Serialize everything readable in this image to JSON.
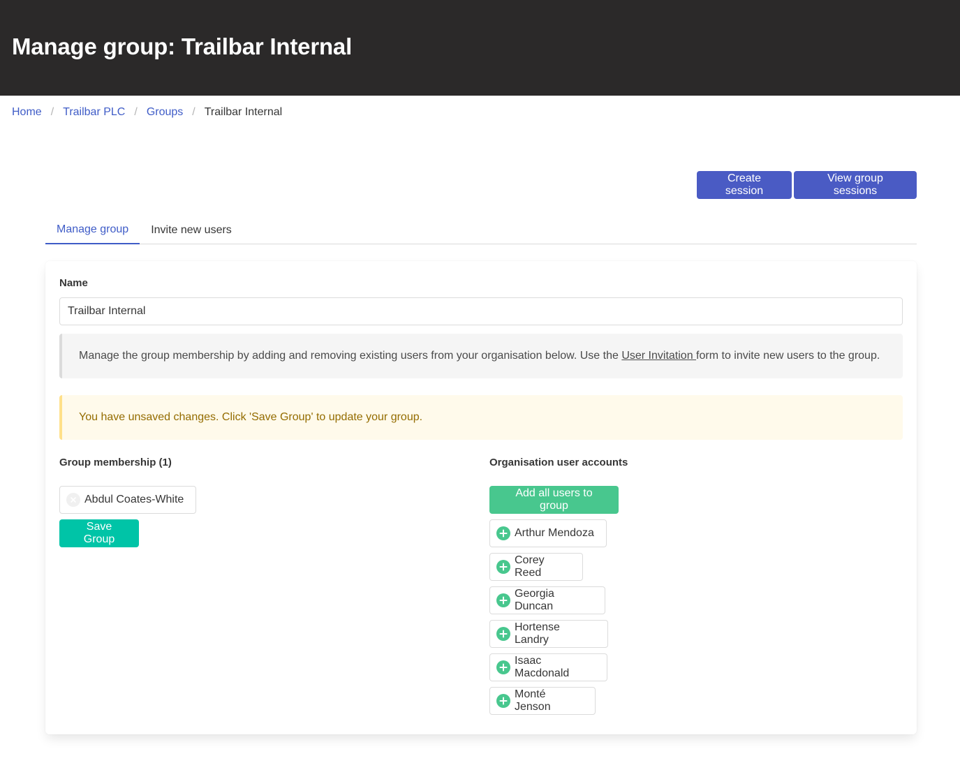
{
  "header": {
    "title": "Manage group: Trailbar Internal"
  },
  "breadcrumb": {
    "items": [
      "Home",
      "Trailbar PLC",
      "Groups"
    ],
    "current": "Trailbar Internal",
    "separator": "/"
  },
  "actions": {
    "create_session": "Create session",
    "view_group_sessions": "View group sessions"
  },
  "tabs": [
    {
      "label": "Manage group",
      "active": true
    },
    {
      "label": "Invite new users",
      "active": false
    }
  ],
  "form": {
    "name_label": "Name",
    "name_value": "Trailbar Internal",
    "info_before": "Manage the group membership by adding and removing existing users from your organisation below. Use the ",
    "info_link": "User Invitation ",
    "info_after": "form to invite new users to the group.",
    "warning": "You have unsaved changes. Click 'Save Group' to update your group."
  },
  "membership": {
    "heading": "Group membership (1)",
    "members": [
      "Abdul Coates-White"
    ],
    "save_label": "Save Group"
  },
  "org_accounts": {
    "heading": "Organisation user accounts",
    "add_all_label": "Add all users to group",
    "users": [
      "Arthur Mendoza",
      "Corey Reed",
      "Georgia Duncan",
      "Hortense Landry",
      "Isaac Macdonald",
      "Monté Jenson"
    ]
  },
  "colors": {
    "header_bg": "#2b2929",
    "primary": "#4a5bc4",
    "success": "#48c78e",
    "teal": "#00c4a7",
    "link": "#3f5cc7"
  }
}
